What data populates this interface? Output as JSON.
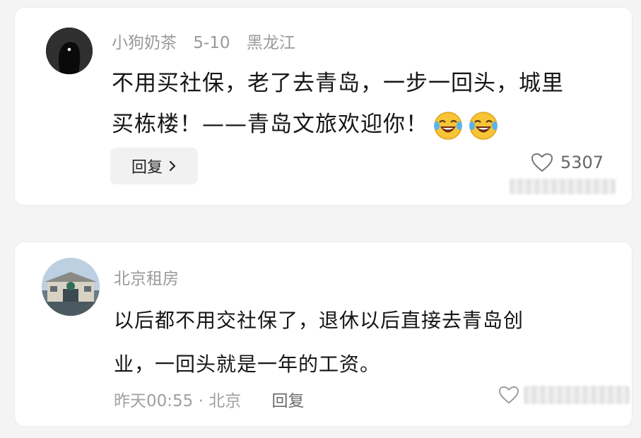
{
  "comments": [
    {
      "username": "小狗奶茶",
      "date": "5-10",
      "location": "黑龙江",
      "text_line1": "不用买社保，老了去青岛，一步一回头，城里",
      "text_line2": "买栋楼！——青岛文旅欢迎你！",
      "emoji": "laughing-crying-emoji",
      "reply_label": "回复",
      "like_count": "5307"
    },
    {
      "username": "北京租房",
      "text_line1": "以后都不用交社保了，退休以后直接去青岛创",
      "text_line2": "业，一回头就是一年的工资。",
      "time_location": "昨天00:55 · 北京",
      "reply_label": "回复"
    }
  ],
  "colors": {
    "card_bg": "#ffffff",
    "page_bg": "#f4f4f4",
    "meta_text": "#9a9a9a",
    "body_text": "#161616"
  }
}
